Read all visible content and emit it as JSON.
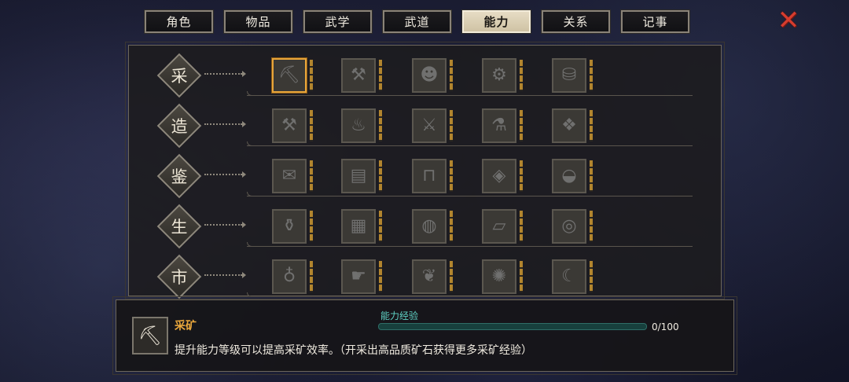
{
  "tabs": [
    {
      "label": "角色",
      "active": false
    },
    {
      "label": "物品",
      "active": false
    },
    {
      "label": "武学",
      "active": false
    },
    {
      "label": "武道",
      "active": false
    },
    {
      "label": "能力",
      "active": true
    },
    {
      "label": "关系",
      "active": false
    },
    {
      "label": "记事",
      "active": false
    }
  ],
  "close_icon": "close-x-icon",
  "categories": [
    {
      "label": "采",
      "slots": [
        "ore-icon",
        "hammer-icon",
        "mask-icon",
        "tool-icon",
        "bucket-icon"
      ]
    },
    {
      "label": "造",
      "slots": [
        "anvil-icon",
        "forge-icon",
        "weapon-rack-icon",
        "alchemy-icon",
        "loom-icon"
      ]
    },
    {
      "label": "鉴",
      "slots": [
        "scroll-icon",
        "book-icon",
        "table-icon",
        "gem-icon",
        "bowl-icon"
      ]
    },
    {
      "label": "生",
      "slots": [
        "pot-icon",
        "cloth-icon",
        "plate-icon",
        "map-icon",
        "rope-icon"
      ]
    },
    {
      "label": "市",
      "slots": [
        "bag-icon",
        "hand-icon",
        "food-icon",
        "gear-icon",
        "horn-icon"
      ]
    }
  ],
  "selected_slot": {
    "row": 0,
    "col": 0
  },
  "info": {
    "icon": "pickaxe-ore-icon",
    "title": "采矿",
    "description": "提升能力等级可以提高采矿效率。（开采出高品质矿石获得更多采矿经验）",
    "exp_label": "能力经验",
    "exp_value": "0/100",
    "exp_fraction": 0
  },
  "colors": {
    "accent": "#e9a73c",
    "exp": "#4ec4b6",
    "close": "#d63c2e"
  }
}
